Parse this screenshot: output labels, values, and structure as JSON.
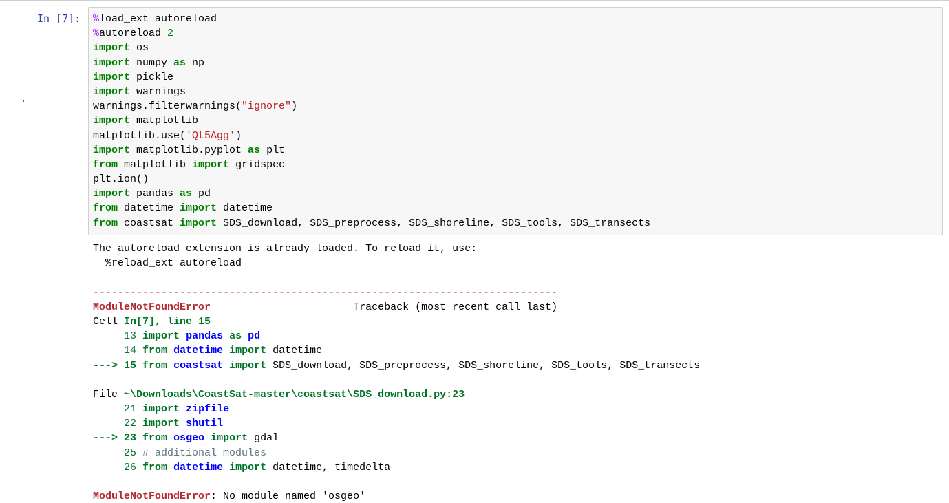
{
  "cell": {
    "prompt": "In [7]:",
    "code_lines": [
      [
        {
          "t": "%",
          "c": "magic"
        },
        {
          "t": "load_ext autoreload",
          "c": ""
        }
      ],
      [
        {
          "t": "%",
          "c": "magic"
        },
        {
          "t": "autoreload ",
          "c": ""
        },
        {
          "t": "2",
          "c": "num"
        }
      ],
      [
        {
          "t": "import",
          "c": "kw"
        },
        {
          "t": " os",
          "c": ""
        }
      ],
      [
        {
          "t": "import",
          "c": "kw"
        },
        {
          "t": " numpy ",
          "c": ""
        },
        {
          "t": "as",
          "c": "kw"
        },
        {
          "t": " np",
          "c": ""
        }
      ],
      [
        {
          "t": "import",
          "c": "kw"
        },
        {
          "t": " pickle",
          "c": ""
        }
      ],
      [
        {
          "t": "import",
          "c": "kw"
        },
        {
          "t": " warnings",
          "c": ""
        }
      ],
      [
        {
          "t": "warnings.filterwarnings(",
          "c": ""
        },
        {
          "t": "\"ignore\"",
          "c": "str"
        },
        {
          "t": ")",
          "c": ""
        }
      ],
      [
        {
          "t": "import",
          "c": "kw"
        },
        {
          "t": " matplotlib",
          "c": ""
        }
      ],
      [
        {
          "t": "matplotlib.use(",
          "c": ""
        },
        {
          "t": "'Qt5Agg'",
          "c": "str"
        },
        {
          "t": ")",
          "c": ""
        }
      ],
      [
        {
          "t": "import",
          "c": "kw"
        },
        {
          "t": " matplotlib.pyplot ",
          "c": ""
        },
        {
          "t": "as",
          "c": "kw"
        },
        {
          "t": " plt",
          "c": ""
        }
      ],
      [
        {
          "t": "from",
          "c": "kw"
        },
        {
          "t": " matplotlib ",
          "c": ""
        },
        {
          "t": "import",
          "c": "kw"
        },
        {
          "t": " gridspec",
          "c": ""
        }
      ],
      [
        {
          "t": "plt.ion()",
          "c": ""
        }
      ],
      [
        {
          "t": "import",
          "c": "kw"
        },
        {
          "t": " pandas ",
          "c": ""
        },
        {
          "t": "as",
          "c": "kw"
        },
        {
          "t": " pd",
          "c": ""
        }
      ],
      [
        {
          "t": "from",
          "c": "kw"
        },
        {
          "t": " datetime ",
          "c": ""
        },
        {
          "t": "import",
          "c": "kw"
        },
        {
          "t": " datetime",
          "c": ""
        }
      ],
      [
        {
          "t": "from",
          "c": "kw"
        },
        {
          "t": " coastsat ",
          "c": ""
        },
        {
          "t": "import",
          "c": "kw"
        },
        {
          "t": " SDS_download, SDS_preprocess, SDS_shoreline, SDS_tools, SDS_transects",
          "c": ""
        }
      ]
    ]
  },
  "output": {
    "lines": [
      [
        {
          "t": "The autoreload extension is already loaded. To reload it, use:",
          "c": ""
        }
      ],
      [
        {
          "t": "  %reload_ext autoreload",
          "c": ""
        }
      ],
      [
        {
          "t": "",
          "c": ""
        }
      ],
      [
        {
          "t": "---------------------------------------------------------------------------",
          "c": "err-red"
        }
      ],
      [
        {
          "t": "ModuleNotFoundError",
          "c": "err-name"
        },
        {
          "t": "                       Traceback (most recent call last)",
          "c": ""
        }
      ],
      [
        {
          "t": "Cell ",
          "c": ""
        },
        {
          "t": "In[7], line 15",
          "c": "tb-greenb"
        }
      ],
      [
        {
          "t": "     13",
          "c": "tb-green"
        },
        {
          "t": " ",
          "c": ""
        },
        {
          "t": "import",
          "c": "tb-greenb"
        },
        {
          "t": " ",
          "c": ""
        },
        {
          "t": "pandas",
          "c": "tb-blue"
        },
        {
          "t": " ",
          "c": ""
        },
        {
          "t": "as",
          "c": "tb-greenb"
        },
        {
          "t": " ",
          "c": ""
        },
        {
          "t": "pd",
          "c": "tb-blue"
        }
      ],
      [
        {
          "t": "     14",
          "c": "tb-green"
        },
        {
          "t": " ",
          "c": ""
        },
        {
          "t": "from",
          "c": "tb-greenb"
        },
        {
          "t": " ",
          "c": ""
        },
        {
          "t": "datetime",
          "c": "tb-blue"
        },
        {
          "t": " ",
          "c": ""
        },
        {
          "t": "import",
          "c": "tb-greenb"
        },
        {
          "t": " datetime",
          "c": ""
        }
      ],
      [
        {
          "t": "---> 15",
          "c": "tb-greenb"
        },
        {
          "t": " ",
          "c": ""
        },
        {
          "t": "from",
          "c": "tb-greenb"
        },
        {
          "t": " ",
          "c": ""
        },
        {
          "t": "coastsat",
          "c": "tb-blue"
        },
        {
          "t": " ",
          "c": ""
        },
        {
          "t": "import",
          "c": "tb-greenb"
        },
        {
          "t": " SDS_download, SDS_preprocess, SDS_shoreline, SDS_tools, SDS_transects",
          "c": ""
        }
      ],
      [
        {
          "t": "",
          "c": ""
        }
      ],
      [
        {
          "t": "File ",
          "c": ""
        },
        {
          "t": "~\\Downloads\\CoastSat-master\\coastsat\\SDS_download.py:23",
          "c": "tb-greenb"
        }
      ],
      [
        {
          "t": "     21",
          "c": "tb-green"
        },
        {
          "t": " ",
          "c": ""
        },
        {
          "t": "import",
          "c": "tb-greenb"
        },
        {
          "t": " ",
          "c": ""
        },
        {
          "t": "zipfile",
          "c": "tb-blue"
        }
      ],
      [
        {
          "t": "     22",
          "c": "tb-green"
        },
        {
          "t": " ",
          "c": ""
        },
        {
          "t": "import",
          "c": "tb-greenb"
        },
        {
          "t": " ",
          "c": ""
        },
        {
          "t": "shutil",
          "c": "tb-blue"
        }
      ],
      [
        {
          "t": "---> 23",
          "c": "tb-greenb"
        },
        {
          "t": " ",
          "c": ""
        },
        {
          "t": "from",
          "c": "tb-greenb"
        },
        {
          "t": " ",
          "c": ""
        },
        {
          "t": "osgeo",
          "c": "tb-blue"
        },
        {
          "t": " ",
          "c": ""
        },
        {
          "t": "import",
          "c": "tb-greenb"
        },
        {
          "t": " gdal",
          "c": ""
        }
      ],
      [
        {
          "t": "     25",
          "c": "tb-green"
        },
        {
          "t": " ",
          "c": ""
        },
        {
          "t": "# additional modules",
          "c": "tb-gray"
        }
      ],
      [
        {
          "t": "     26",
          "c": "tb-green"
        },
        {
          "t": " ",
          "c": ""
        },
        {
          "t": "from",
          "c": "tb-greenb"
        },
        {
          "t": " ",
          "c": ""
        },
        {
          "t": "datetime",
          "c": "tb-blue"
        },
        {
          "t": " ",
          "c": ""
        },
        {
          "t": "import",
          "c": "tb-greenb"
        },
        {
          "t": " datetime, timedelta",
          "c": ""
        }
      ],
      [
        {
          "t": "",
          "c": ""
        }
      ],
      [
        {
          "t": "ModuleNotFoundError",
          "c": "err-name"
        },
        {
          "t": ": No module named 'osgeo'",
          "c": ""
        }
      ]
    ]
  }
}
